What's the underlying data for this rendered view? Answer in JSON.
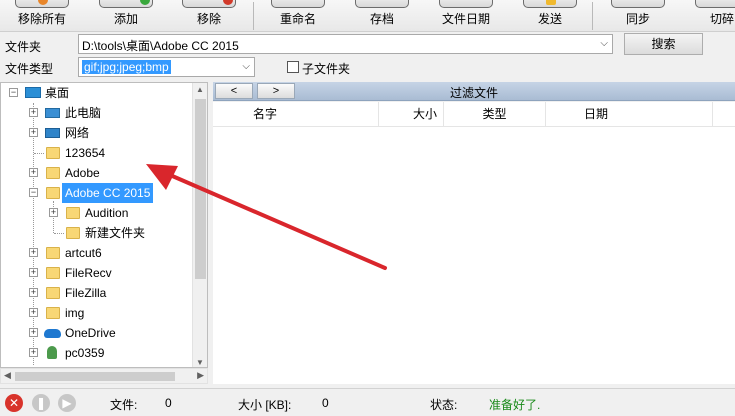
{
  "toolbar": {
    "remove_all": "移除所有",
    "add": "添加",
    "remove": "移除",
    "rename": "重命名",
    "archive": "存档",
    "file_date": "文件日期",
    "send": "发送",
    "sync": "同步",
    "cut": "切碎"
  },
  "fields": {
    "folder_label": "文件夹",
    "folder_value": "D:\\tools\\桌面\\Adobe CC 2015",
    "filetype_label": "文件类型",
    "filetype_value": "gif;jpg;jpeg;bmp",
    "subfolder_label": "子文件夹",
    "search_button": "搜索"
  },
  "tree": {
    "items": [
      {
        "label": "桌面"
      },
      {
        "label": "此电脑"
      },
      {
        "label": "网络"
      },
      {
        "label": "123654"
      },
      {
        "label": "Adobe"
      },
      {
        "label": "Adobe CC 2015"
      },
      {
        "label": "Audition"
      },
      {
        "label": "新建文件夹"
      },
      {
        "label": "artcut6"
      },
      {
        "label": "FileRecv"
      },
      {
        "label": "FileZilla"
      },
      {
        "label": "img"
      },
      {
        "label": "OneDrive"
      },
      {
        "label": "pc0359"
      }
    ]
  },
  "filter": {
    "prev": "<",
    "next": ">",
    "title": "过滤文件"
  },
  "columns": {
    "name": "名字",
    "size": "大小",
    "type": "类型",
    "date": "日期"
  },
  "status": {
    "files_label": "文件:",
    "files_value": "0",
    "size_label": "大小 [KB]:",
    "size_value": "0",
    "state_label": "状态:",
    "state_value": "准备好了."
  },
  "colors": {
    "ready_text": "#1a8a1a",
    "selection": "#3399ff",
    "annotation_arrow": "#d9262c"
  }
}
